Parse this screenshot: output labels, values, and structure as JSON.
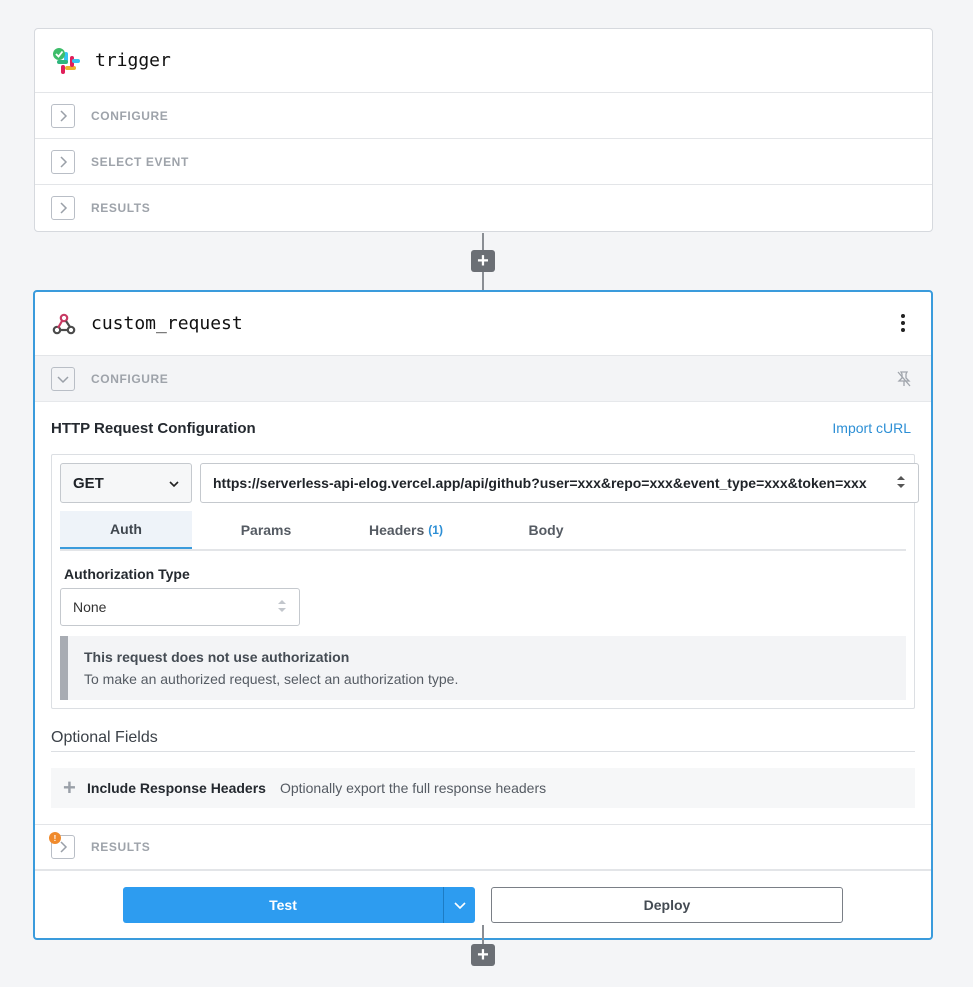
{
  "trigger_card": {
    "title": "trigger",
    "icon": "slack-icon",
    "rows": [
      {
        "label": "CONFIGURE"
      },
      {
        "label": "SELECT EVENT"
      },
      {
        "label": "RESULTS"
      }
    ]
  },
  "add_step": {
    "label": "+"
  },
  "request_card": {
    "title": "custom_request",
    "icon": "webhook-icon",
    "configure_label": "CONFIGURE",
    "section_title": "HTTP Request Configuration",
    "import_curl": "Import cURL",
    "method": "GET",
    "url": "https://serverless-api-elog.vercel.app/api/github?user=xxx&repo=xxx&event_type=xxx&token=xxx",
    "tabs": [
      {
        "label": "Auth",
        "active": true
      },
      {
        "label": "Params"
      },
      {
        "label": "Headers",
        "count": "(1)"
      },
      {
        "label": "Body"
      }
    ],
    "auth_type_label": "Authorization Type",
    "auth_type_value": "None",
    "notice_title": "This request does not use authorization",
    "notice_text": "To make an authorized request, select an authorization type.",
    "optional_title": "Optional Fields",
    "optional_fields": [
      {
        "name": "Include Response Headers",
        "description": "Optionally export the full response headers"
      }
    ],
    "results_label": "RESULTS",
    "results_badge": "!",
    "test_label": "Test",
    "deploy_label": "Deploy"
  },
  "colors": {
    "accent": "#2d9cf0",
    "active_border": "#3a9bdc",
    "warning": "#f08a2c"
  }
}
